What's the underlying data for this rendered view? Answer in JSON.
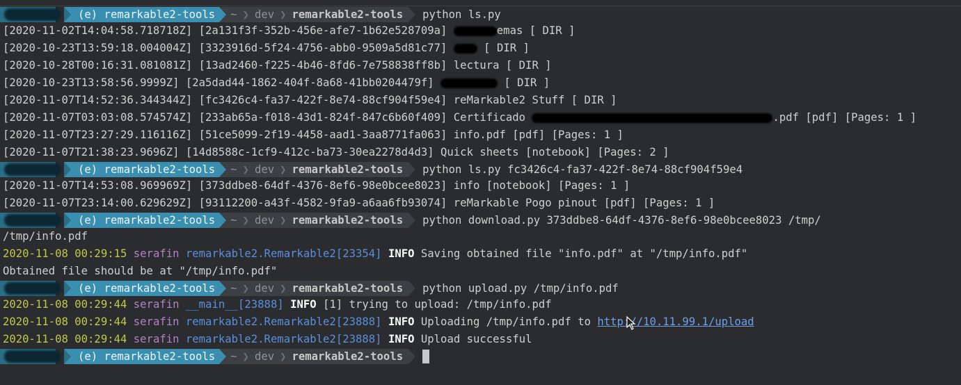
{
  "prompt": {
    "venv": "(e) remarkable2-tools",
    "home": "~",
    "dir1": "dev",
    "current_dir": "remarkable2-tools",
    "separator": "❯"
  },
  "commands": {
    "ls": "python ls.py",
    "ls_folder": "python ls.py fc3426c4-fa37-422f-8e74-88cf904f59e4",
    "download": "python download.py 373ddbe8-64df-4376-8ef6-98e0bcee8023 /tmp/",
    "upload": "python upload.py /tmp/info.pdf"
  },
  "listing1": [
    {
      "pre": "[2020-11-02T14:04:58.718718Z] [2a131f3f-352b-456e-afe7-1b62e528709a] ",
      "post": "emas [ DIR ]",
      "redact_w": 62
    },
    {
      "pre": "[2020-10-23T13:59:18.004004Z] [3323916d-5f24-4756-abb0-9509a5d81c77] ",
      "post": " [ DIR ]",
      "redact_w": 34
    },
    {
      "pre": "[2020-10-28T00:16:31.081081Z] [13ad2460-f225-4b46-8fd6-7e758838ff8b] lectura [ DIR ]",
      "post": "",
      "redact_w": 0
    },
    {
      "pre": "[2020-10-23T13:58:56.9999Z] [2a5dad44-1862-404f-8a68-41bb0204479f] ",
      "post": " [ DIR ]",
      "redact_w": 82
    },
    {
      "pre": "[2020-11-07T14:52:36.344344Z] [fc3426c4-fa37-422f-8e74-88cf904f59e4] reMarkable2 Stuff [ DIR ]",
      "post": "",
      "redact_w": 0
    },
    {
      "pre": "[2020-11-07T03:03:08.574574Z] [233ab65a-f018-43d1-824f-847c6b60f409] Certificado ",
      "post": ".pdf [pdf] [Pages: 1 ]",
      "redact_w": 346
    },
    {
      "pre": "[2020-11-07T23:27:29.116116Z] [51ce5099-2f19-4458-aad1-3aa8771fa063] info.pdf [pdf] [Pages: 1 ]",
      "post": "",
      "redact_w": 0
    },
    {
      "pre": "[2020-11-07T21:38:23.9696Z] [14d8588c-1cf9-412c-ba73-30ea2278d4d3] Quick sheets [notebook] [Pages: 2 ]",
      "post": "",
      "redact_w": 0
    }
  ],
  "listing2": [
    "[2020-11-07T14:53:08.969969Z] [373ddbe8-64df-4376-8ef6-98e0bcee8023] info [notebook] [Pages: 1 ]",
    "[2020-11-07T23:14:00.629629Z] [93112200-a43f-4582-9fa9-a6aa6fb93074] reMarkable Pogo pinout [pdf] [Pages: 1 ]"
  ],
  "download_out": {
    "path": "/tmp/info.pdf",
    "log": {
      "date": "2020-11-08 00:29:15",
      "host": "serafin",
      "module": "remarkable2.Remarkable2[23354]",
      "level": "INFO",
      "msg": "Saving obtained file \"info.pdf\" at \"/tmp/info.pdf\""
    },
    "result": "Obtained file should be at \"/tmp/info.pdf\""
  },
  "upload_out": [
    {
      "date": "2020-11-08 00:29:44",
      "host": "serafin",
      "module": "__main__[23888]",
      "level": "INFO",
      "msg": "[1] trying to upload: /tmp/info.pdf",
      "link": ""
    },
    {
      "date": "2020-11-08 00:29:44",
      "host": "serafin",
      "module": "remarkable2.Remarkable2[23888]",
      "level": "INFO",
      "msg": "Uploading /tmp/info.pdf to ",
      "link": "http://10.11.99.1/upload"
    },
    {
      "date": "2020-11-08 00:29:44",
      "host": "serafin",
      "module": "remarkable2.Remarkable2[23888]",
      "level": "INFO",
      "msg": "Upload successful",
      "link": ""
    }
  ],
  "colors": {
    "background": "#2b2c2f",
    "venv_segment": "#3a8fb0",
    "log_date": "#c1c945",
    "log_host": "#b382c6",
    "log_module": "#5b8fd8"
  }
}
